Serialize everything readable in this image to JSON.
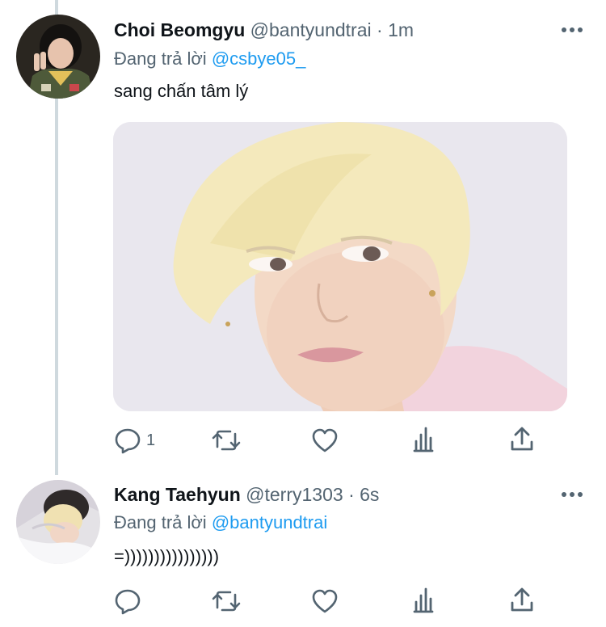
{
  "tweets": [
    {
      "display_name": "Choi Beomgyu",
      "handle": "@bantyundtrai",
      "time": "· 1m",
      "reply_prefix": "Đang trả lời",
      "reply_mention": "@csbye05_",
      "text": "sang chấn tâm lý",
      "reply_count": "1",
      "avatar_icon": "avatar-photo",
      "media_icon": "photo"
    },
    {
      "display_name": "Kang Taehyun",
      "handle": "@terry1303",
      "time": "· 6s",
      "reply_prefix": "Đang trả lời",
      "reply_mention": "@bantyundtrai",
      "text": "=))))))))))))))))",
      "reply_count": "",
      "avatar_icon": "avatar-photo"
    }
  ],
  "icons": [
    "reply-icon",
    "retweet-icon",
    "like-icon",
    "analytics-icon",
    "share-icon",
    "more-icon"
  ],
  "colors": {
    "accent": "#1d9bf0",
    "muted": "#536471",
    "text": "#0f1419",
    "thread_line": "#cfd9de"
  }
}
